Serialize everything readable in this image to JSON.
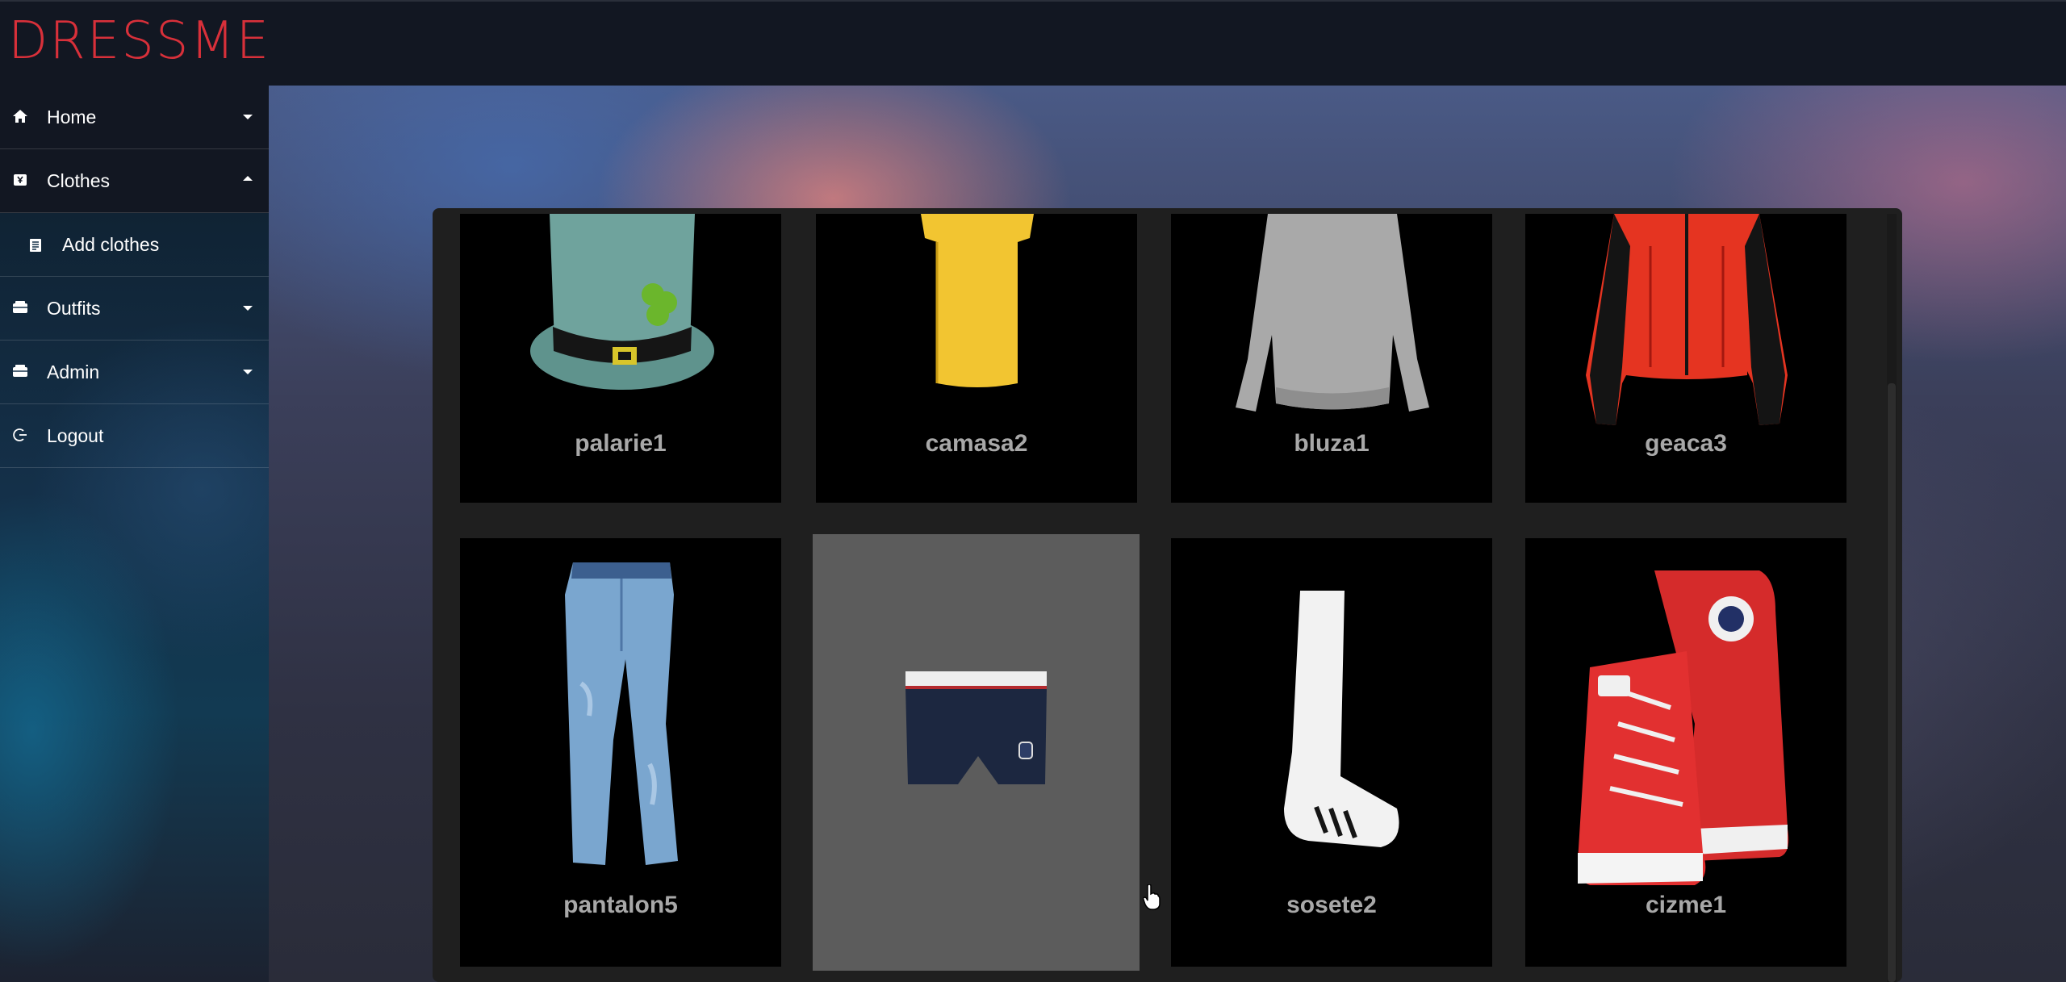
{
  "app": {
    "logo_text": "DRESSME"
  },
  "sidebar": {
    "items": [
      {
        "label": "Home",
        "icon": "home-icon",
        "caret": "down"
      },
      {
        "label": "Clothes",
        "icon": "clothes-icon",
        "caret": "up"
      },
      {
        "label": "Add clothes",
        "icon": "document-icon",
        "sub": true
      },
      {
        "label": "Outfits",
        "icon": "folder-icon",
        "caret": "down"
      },
      {
        "label": "Admin",
        "icon": "folder-icon",
        "caret": "down"
      },
      {
        "label": "Logout",
        "icon": "logout-icon"
      }
    ]
  },
  "clothes": {
    "items": [
      {
        "name": "palarie1",
        "image": "hat-image"
      },
      {
        "name": "camasa2",
        "image": "shirt-image"
      },
      {
        "name": "bluza1",
        "image": "sweater-image"
      },
      {
        "name": "geaca3",
        "image": "jacket-image"
      },
      {
        "name": "pantalon5",
        "image": "jeans-image"
      },
      {
        "name": "",
        "image": "underwear-image",
        "hovered": true
      },
      {
        "name": "sosete2",
        "image": "sock-image"
      },
      {
        "name": "cizme1",
        "image": "sneakers-image"
      }
    ]
  },
  "colors": {
    "accent": "#d8303a",
    "header": "#121722",
    "card": "#000000",
    "card_hover": "#5c5c5c",
    "card_text": "#a8a8a8"
  }
}
